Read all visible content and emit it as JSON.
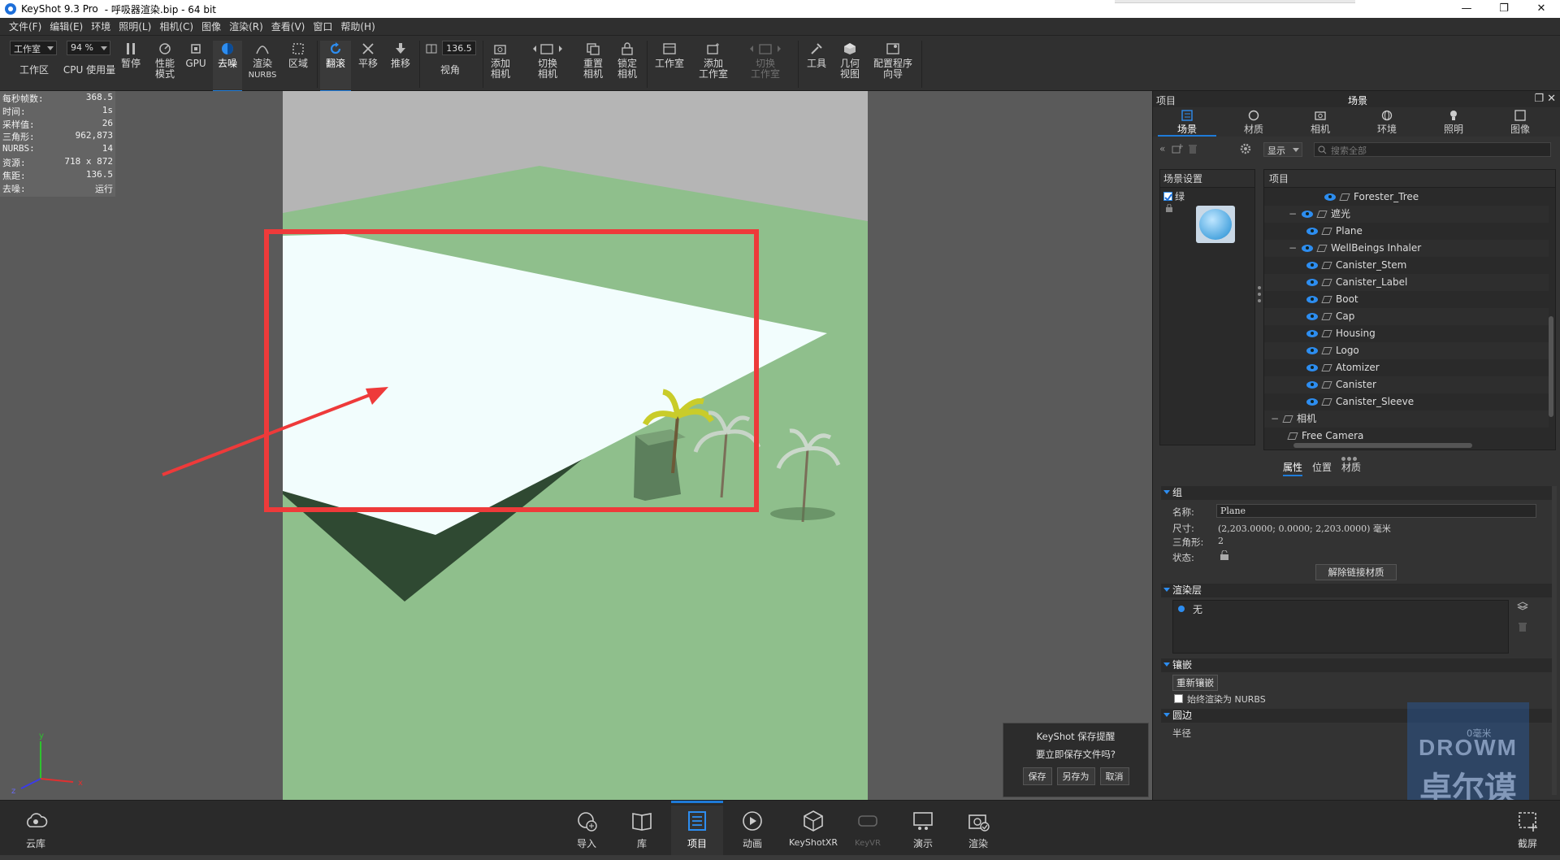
{
  "window": {
    "app_title": "KeyShot 9.3 Pro",
    "file_title": "- 呼吸器渲染.bip - 64 bit",
    "minimize": "—",
    "maximize": "❐",
    "close": "✕"
  },
  "menu": [
    "文件(F)",
    "编辑(E)",
    "环境",
    "照明(L)",
    "相机(C)",
    "图像",
    "渲染(R)",
    "查看(V)",
    "窗口",
    "帮助(H)"
  ],
  "toolbar": {
    "workspace_select": "工作室",
    "workspace_label": "工作区",
    "cpu_value": "94 %",
    "cpu_label": "CPU 使用量",
    "pause": "暂停",
    "perf_mode_1": "性能",
    "perf_mode_2": "模式",
    "gpu": "GPU",
    "denoise": "去噪",
    "render_nurbs_1": "渲染",
    "render_nurbs_2": "NURBS",
    "region": "区域",
    "tumble": "翻滚",
    "pan": "平移",
    "dolly": "推移",
    "fov_value": "136.5",
    "fov_label": "视角",
    "add_camera_1": "添加",
    "add_camera_2": "相机",
    "switch_camera_1": "切换",
    "switch_camera_2": "相机",
    "reset_camera_1": "重置",
    "reset_camera_2": "相机",
    "lock_camera_1": "锁定",
    "lock_camera_2": "相机",
    "studio": "工作室",
    "add_studio_1": "添加",
    "add_studio_2": "工作室",
    "switch_studio_1": "切换",
    "switch_studio_2": "工作室",
    "tools": "工具",
    "geometry_view_1": "几何",
    "geometry_view_2": "视图",
    "config_wizard_1": "配置程序",
    "config_wizard_2": "向导"
  },
  "stats": [
    {
      "label": "每秒帧数:",
      "value": "368.5"
    },
    {
      "label": "时间:",
      "value": "1s"
    },
    {
      "label": "采样值:",
      "value": "26"
    },
    {
      "label": "三角形:",
      "value": "962,873"
    },
    {
      "label": "NURBS:",
      "value": "14"
    },
    {
      "label": "资源:",
      "value": "718 x 872"
    },
    {
      "label": "焦距:",
      "value": "136.5"
    },
    {
      "label": "去噪:",
      "value": "运行"
    }
  ],
  "axes": {
    "x": "x",
    "y": "y",
    "z": "z"
  },
  "save_dialog": {
    "title": "KeyShot 保存提醒",
    "message": "要立即保存文件吗?",
    "save": "保存",
    "save_as": "另存为",
    "cancel": "取消"
  },
  "panel": {
    "left_title": "项目",
    "center_title": "场景",
    "tabs": [
      "场景",
      "材质",
      "相机",
      "环境",
      "照明",
      "图像"
    ],
    "display_select": "显示",
    "search_placeholder": "搜索全部",
    "scene_settings_title": "场景设置",
    "scene_settings_item": "绿",
    "tree_title": "项目",
    "tree": [
      {
        "label": "Forester_Tree",
        "indent": 3,
        "kind": "part"
      },
      {
        "label": "遮光",
        "indent": 1,
        "kind": "group"
      },
      {
        "label": "Plane",
        "indent": 2,
        "kind": "part"
      },
      {
        "label": "WellBeings Inhaler",
        "indent": 1,
        "kind": "group"
      },
      {
        "label": "Canister_Stem",
        "indent": 2,
        "kind": "part"
      },
      {
        "label": "Canister_Label",
        "indent": 2,
        "kind": "part"
      },
      {
        "label": "Boot",
        "indent": 2,
        "kind": "part"
      },
      {
        "label": "Cap",
        "indent": 2,
        "kind": "part"
      },
      {
        "label": "Housing",
        "indent": 2,
        "kind": "part"
      },
      {
        "label": "Logo",
        "indent": 2,
        "kind": "part"
      },
      {
        "label": "Atomizer",
        "indent": 2,
        "kind": "part"
      },
      {
        "label": "Canister",
        "indent": 2,
        "kind": "part"
      },
      {
        "label": "Canister_Sleeve",
        "indent": 2,
        "kind": "part"
      },
      {
        "label": "相机",
        "indent": 0,
        "kind": "camera-group"
      },
      {
        "label": "Free Camera",
        "indent": 1,
        "kind": "camera"
      }
    ],
    "subtabs": [
      "属性",
      "位置",
      "材质"
    ],
    "group_section": "组",
    "name_label": "名称:",
    "name_value": "Plane",
    "size_label": "尺寸:",
    "size_value": "(2,203.0000; 0.0000; 2,203.0000) 毫米",
    "tris_label": "三角形:",
    "tris_value": "2",
    "state_label": "状态:",
    "unlink_button": "解除链接材质",
    "render_layer_section": "渲染层",
    "render_layer_item": "无",
    "tessellation_section": "镶嵌",
    "retessellate_button": "重新镶嵌",
    "always_nurbs_label": "始终渲染为 NURBS",
    "rounding_section": "圆边",
    "radius_label": "半径",
    "radius_value": "0毫米"
  },
  "bottombar": {
    "cloud_library": "云库",
    "import": "导入",
    "library": "库",
    "project": "项目",
    "animation": "动画",
    "keyshotxr": "KeyShotXR",
    "keyvr": "KeyVR",
    "present": "演示",
    "render": "渲染",
    "screenshot": "截屏"
  },
  "watermark": {
    "line1": "DROWM",
    "line2": "卓尔谟"
  },
  "colors": {
    "accent": "#1e7bd9",
    "annotation_red": "#ee3a3a",
    "ground_green": "#8fbf8c",
    "plane_white": "#f2fdfd",
    "sky_grey": "#b5b5b5"
  }
}
